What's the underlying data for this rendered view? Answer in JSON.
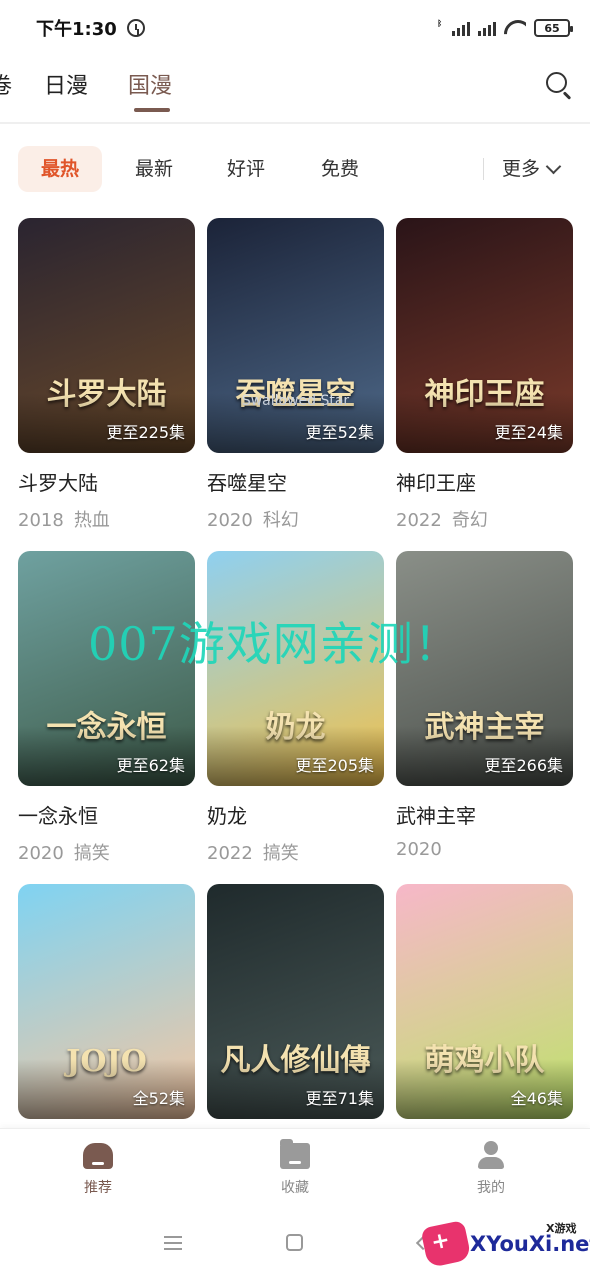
{
  "status_bar": {
    "time": "下午1:30",
    "battery": "65"
  },
  "top_tabs": [
    {
      "label": "日漫",
      "active": false
    },
    {
      "label": "国漫",
      "active": true
    }
  ],
  "filters": {
    "chips": [
      {
        "label": "最热",
        "active": true
      },
      {
        "label": "最新",
        "active": false
      },
      {
        "label": "好评",
        "active": false
      },
      {
        "label": "免费",
        "active": false
      }
    ],
    "more_label": "更多"
  },
  "cards": [
    {
      "title": "斗罗大陆",
      "year": "2018",
      "genre": "热血",
      "episodes": "更至225集",
      "cover_text": "斗罗大陆",
      "colors": [
        "#2a2430",
        "#6b4a2a"
      ]
    },
    {
      "title": "吞噬星空",
      "year": "2020",
      "genre": "科幻",
      "episodes": "更至52集",
      "cover_text": "吞噬星空",
      "cover_sub": "Swallowed Star",
      "colors": [
        "#1b2338",
        "#4f6a8a"
      ]
    },
    {
      "title": "神印王座",
      "year": "2022",
      "genre": "奇幻",
      "episodes": "更至24集",
      "cover_text": "神印王座",
      "colors": [
        "#2a1418",
        "#7a3a2a"
      ]
    },
    {
      "title": "一念永恒",
      "year": "2020",
      "genre": "搞笑",
      "episodes": "更至62集",
      "cover_text": "一念永恒",
      "colors": [
        "#6fa1a0",
        "#3d5a48"
      ]
    },
    {
      "title": "奶龙",
      "year": "2022",
      "genre": "搞笑",
      "episodes": "更至205集",
      "cover_text": "奶龙",
      "colors": [
        "#8fd0f0",
        "#f2c14a"
      ]
    },
    {
      "title": "武神主宰",
      "year": "2020",
      "genre": "",
      "episodes": "更至266集",
      "cover_text": "武神主宰",
      "colors": [
        "#8a8f88",
        "#4a4f4a"
      ]
    },
    {
      "title": "",
      "year": "",
      "genre": "",
      "episodes": "全52集",
      "cover_text": "JOJO",
      "colors": [
        "#7fd3f2",
        "#f6c6a0"
      ]
    },
    {
      "title": "",
      "year": "",
      "genre": "",
      "episodes": "更至71集",
      "cover_text": "凡人修仙傳",
      "colors": [
        "#1f2a2c",
        "#4b5a58"
      ]
    },
    {
      "title": "",
      "year": "",
      "genre": "",
      "episodes": "全46集",
      "cover_text": "萌鸡小队",
      "colors": [
        "#f7b7c9",
        "#bde36a"
      ]
    }
  ],
  "watermark": "007游戏网亲测！",
  "bottom_nav": [
    {
      "label": "推荐",
      "icon": "home-icon",
      "active": true
    },
    {
      "label": "收藏",
      "icon": "folder-icon",
      "active": false
    },
    {
      "label": "我的",
      "icon": "user-icon",
      "active": false
    }
  ],
  "corner_logo": {
    "site": "XYouXi.net",
    "tag": "X游戏"
  },
  "colors": {
    "accent": "#7a5a50",
    "chip_active_bg": "#fbeee7",
    "chip_active_text": "#e0552a",
    "watermark": "#1fd6b9"
  }
}
